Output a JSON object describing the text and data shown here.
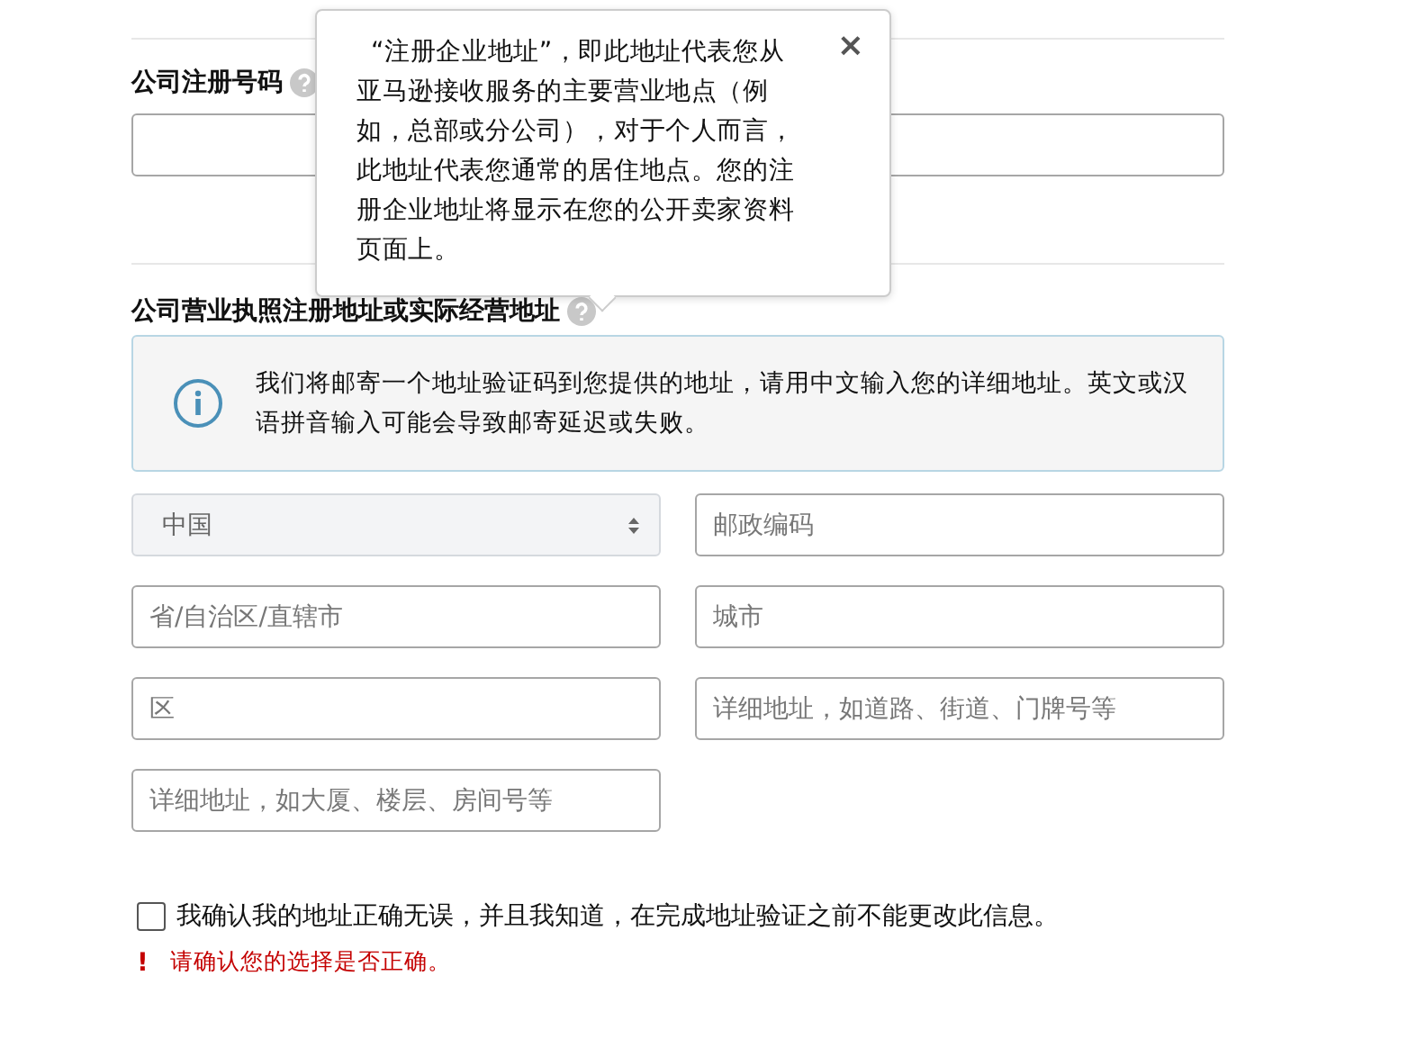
{
  "registration_number": {
    "label": "公司注册号码"
  },
  "tooltip": {
    "text": "“注册企业地址”，即此地址代表您从亚马逊接收服务的主要营业地点（例如，总部或分公司），对于个人而言，此地址代表您通常的居住地点。您的注册企业地址将显示在您的公开卖家资料页面上。",
    "close": "×"
  },
  "address": {
    "label": "公司营业执照注册地址或实际经营地址",
    "notice": "我们将邮寄一个地址验证码到您提供的地址，请用中文输入您的详细地址。英文或汉语拼音输入可能会导致邮寄延迟或失败。",
    "fields": [
      {
        "kind": "select",
        "value": "中国"
      },
      {
        "kind": "input",
        "placeholder": "邮政编码"
      },
      {
        "kind": "input",
        "placeholder": "省/自治区/直辖市"
      },
      {
        "kind": "input",
        "placeholder": "城市"
      },
      {
        "kind": "input",
        "placeholder": "区"
      },
      {
        "kind": "input",
        "placeholder": "详细地址，如道路、街道、门牌号等"
      },
      {
        "kind": "input",
        "placeholder": "详细地址，如大厦、楼层、房间号等"
      }
    ]
  },
  "confirm": {
    "label": "我确认我的地址正确无误，并且我知道，在完成地址验证之前不能更改此信息。",
    "checked": false
  },
  "error": {
    "mark": "!",
    "text": "请确认您的选择是否正确。"
  }
}
